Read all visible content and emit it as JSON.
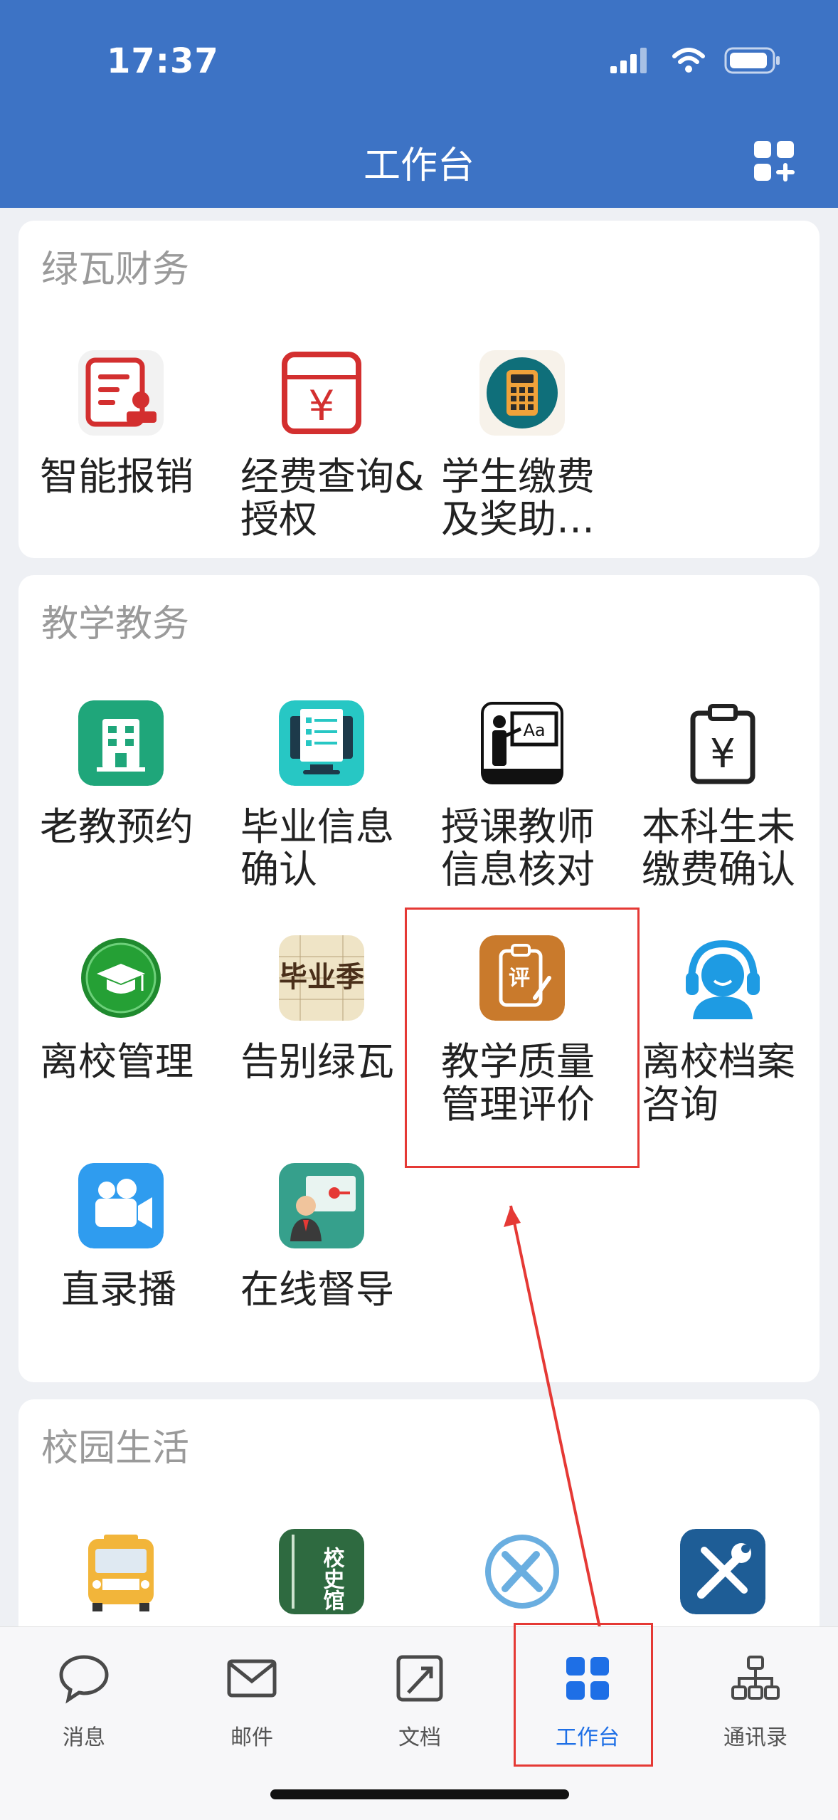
{
  "status": {
    "time": "17:37"
  },
  "header": {
    "title": "工作台"
  },
  "sections": [
    {
      "title": "绿瓦财务",
      "items": [
        {
          "label": "智能报销",
          "icon": "reimbursement-icon"
        },
        {
          "label": "经费查询&授权",
          "icon": "fund-query-icon"
        },
        {
          "label": "学生缴费及奖助…",
          "icon": "calculator-icon"
        }
      ]
    },
    {
      "title": "教学教务",
      "items": [
        {
          "label": "老教预约",
          "icon": "building-icon"
        },
        {
          "label": "毕业信息确认",
          "icon": "graduation-info-icon"
        },
        {
          "label": "授课教师信息核对",
          "icon": "teacher-blackboard-icon"
        },
        {
          "label": "本科生未缴费确认",
          "icon": "clipboard-yen-icon"
        },
        {
          "label": "离校管理",
          "icon": "graduation-cap-icon"
        },
        {
          "label": "告别绿瓦",
          "icon": "farewell-icon",
          "art_text": "毕业季"
        },
        {
          "label": "教学质量管理评价",
          "icon": "evaluation-icon",
          "art_text": "评"
        },
        {
          "label": "离校档案咨询",
          "icon": "customer-service-icon"
        },
        {
          "label": "直录播",
          "icon": "video-camera-icon"
        },
        {
          "label": "在线督导",
          "icon": "online-supervision-icon"
        }
      ]
    },
    {
      "title": "校园生活",
      "items": [
        {
          "label": "",
          "icon": "school-bus-icon"
        },
        {
          "label": "",
          "icon": "school-history-icon",
          "art_text": "校史馆"
        },
        {
          "label": "",
          "icon": "repair-tools-icon"
        },
        {
          "label": "",
          "icon": "wrench-screwdriver-icon"
        }
      ]
    }
  ],
  "tabbar": {
    "tabs": [
      {
        "label": "消息",
        "icon": "chat-bubble-icon"
      },
      {
        "label": "邮件",
        "icon": "mail-icon"
      },
      {
        "label": "文档",
        "icon": "document-icon"
      },
      {
        "label": "工作台",
        "icon": "grid-icon",
        "active": true
      },
      {
        "label": "通讯录",
        "icon": "org-chart-icon"
      }
    ]
  },
  "colors": {
    "header": "#3d73c5",
    "accent": "#1e6fe6",
    "annotation": "#e53935"
  }
}
